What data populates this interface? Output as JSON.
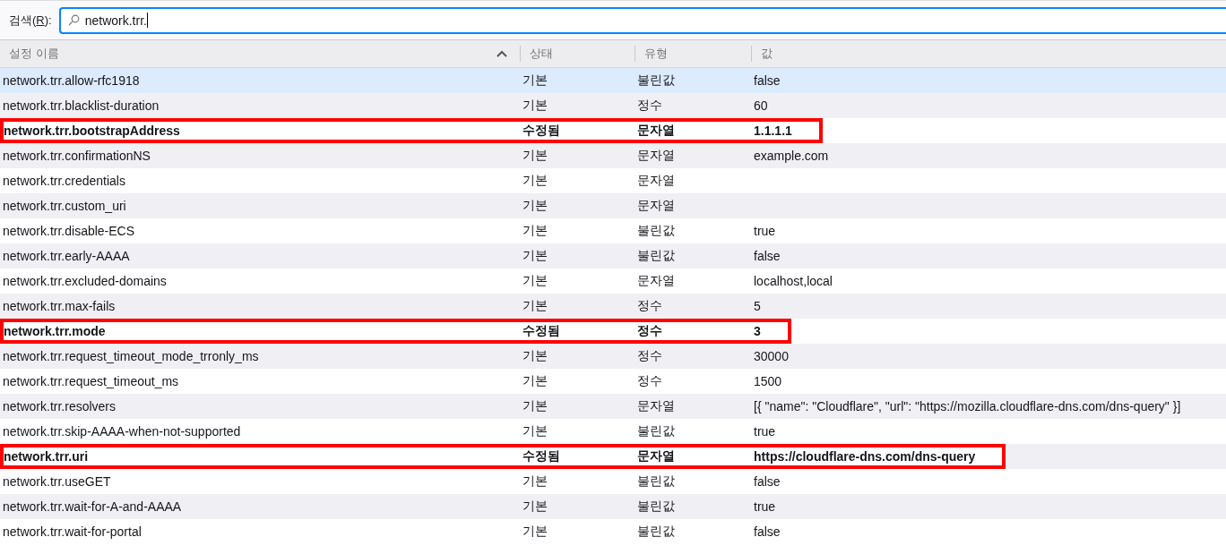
{
  "search": {
    "label": "검색(",
    "accesskey": "R",
    "label_end": "):",
    "value": "network.trr."
  },
  "table": {
    "columns": [
      {
        "label": "설정 이름",
        "sorted": true
      },
      {
        "label": "상태",
        "sorted": false
      },
      {
        "label": "유형",
        "sorted": false
      },
      {
        "label": "값",
        "sorted": false
      }
    ],
    "rows": [
      {
        "name": "network.trr.allow-rfc1918",
        "status": "기본",
        "type": "불린값",
        "value": "false",
        "modified": false,
        "selected": true,
        "outlined": false
      },
      {
        "name": "network.trr.blacklist-duration",
        "status": "기본",
        "type": "정수",
        "value": "60",
        "modified": false,
        "selected": false,
        "outlined": false
      },
      {
        "name": "network.trr.bootstrapAddress",
        "status": "수정됨",
        "type": "문자열",
        "value": "1.1.1.1",
        "modified": true,
        "selected": false,
        "outlined": true
      },
      {
        "name": "network.trr.confirmationNS",
        "status": "기본",
        "type": "문자열",
        "value": "example.com",
        "modified": false,
        "selected": false,
        "outlined": false
      },
      {
        "name": "network.trr.credentials",
        "status": "기본",
        "type": "문자열",
        "modified": false,
        "selected": false,
        "outlined": false
      },
      {
        "name": "network.trr.custom_uri",
        "status": "기본",
        "type": "문자열",
        "modified": false,
        "selected": false,
        "outlined": false
      },
      {
        "name": "network.trr.disable-ECS",
        "status": "기본",
        "type": "불린값",
        "value": "true",
        "modified": false,
        "selected": false,
        "outlined": false
      },
      {
        "name": "network.trr.early-AAAA",
        "status": "기본",
        "type": "불린값",
        "value": "false",
        "modified": false,
        "selected": false,
        "outlined": false
      },
      {
        "name": "network.trr.excluded-domains",
        "status": "기본",
        "type": "문자열",
        "value": "localhost,local",
        "modified": false,
        "selected": false,
        "outlined": false
      },
      {
        "name": "network.trr.max-fails",
        "status": "기본",
        "type": "정수",
        "value": "5",
        "modified": false,
        "selected": false,
        "outlined": false
      },
      {
        "name": "network.trr.mode",
        "status": "수정됨",
        "type": "정수",
        "value": "3",
        "modified": true,
        "selected": false,
        "outlined": true
      },
      {
        "name": "network.trr.request_timeout_mode_trronly_ms",
        "status": "기본",
        "type": "정수",
        "value": "30000",
        "modified": false,
        "selected": false,
        "outlined": false
      },
      {
        "name": "network.trr.request_timeout_ms",
        "status": "기본",
        "type": "정수",
        "value": "1500",
        "modified": false,
        "selected": false,
        "outlined": false
      },
      {
        "name": "network.trr.resolvers",
        "status": "기본",
        "type": "문자열",
        "value": "[{ \"name\": \"Cloudflare\", \"url\": \"https://mozilla.cloudflare-dns.com/dns-query\" }]",
        "modified": false,
        "selected": false,
        "outlined": false
      },
      {
        "name": "network.trr.skip-AAAA-when-not-supported",
        "status": "기본",
        "type": "불린값",
        "value": "true",
        "modified": false,
        "selected": false,
        "outlined": false
      },
      {
        "name": "network.trr.uri",
        "status": "수정됨",
        "type": "문자열",
        "value": "https://cloudflare-dns.com/dns-query",
        "modified": true,
        "selected": false,
        "outlined": true
      },
      {
        "name": "network.trr.useGET",
        "status": "기본",
        "type": "불린값",
        "value": "false",
        "modified": false,
        "selected": false,
        "outlined": false
      },
      {
        "name": "network.trr.wait-for-A-and-AAAA",
        "status": "기본",
        "type": "불린값",
        "value": "true",
        "modified": false,
        "selected": false,
        "outlined": false
      },
      {
        "name": "network.trr.wait-for-portal",
        "status": "기본",
        "type": "불린값",
        "value": "false",
        "modified": false,
        "selected": false,
        "outlined": false
      }
    ]
  }
}
